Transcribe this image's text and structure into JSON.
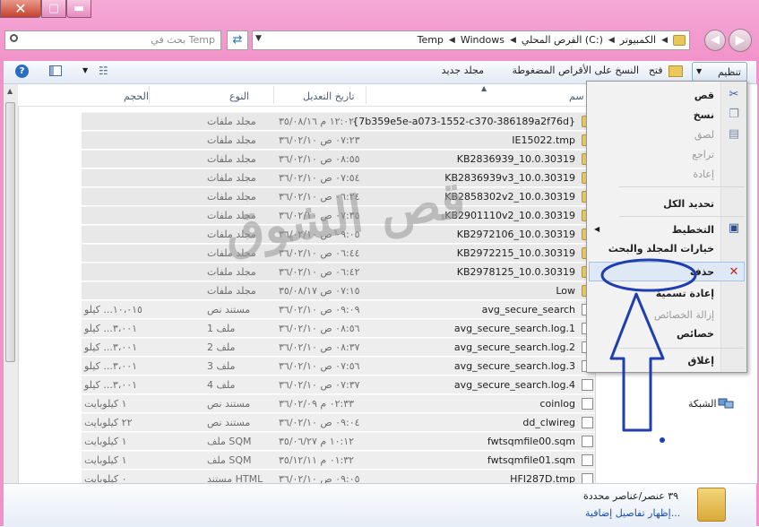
{
  "window": {
    "close_glyph": "✕",
    "max_glyph": "▢",
    "min_glyph": "▬"
  },
  "address": {
    "search_placeholder": "بحث في Temp",
    "crumbs": [
      "الكمبيوتر",
      "القرص المحلي (C:)",
      "Windows",
      "Temp"
    ]
  },
  "toolbar": {
    "organize": "تنظيم",
    "open": "فتح",
    "burn": "النسخ على الأقراص المضغوطة",
    "new_folder": "مجلد جديد"
  },
  "columns": {
    "name": "سم",
    "date": "تاريخ التعديل",
    "type": "النوع",
    "size": "الحجم"
  },
  "rows": [
    {
      "name": "{7b359e5e-a073-1552-c370-386189a2f76d}",
      "date": "١٢:٠٢ م ٣٥/٠٨/١٦",
      "type": "مجلد ملفات",
      "size": "",
      "kind": "folder"
    },
    {
      "name": "IE15022.tmp",
      "date": "٠٧:٢٣ ص ٣٦/٠٢/١٠",
      "type": "مجلد ملفات",
      "size": "",
      "kind": "folder"
    },
    {
      "name": "KB2836939_10.0.30319",
      "date": "٠٨:٥٥ ص ٣٦/٠٢/١٠",
      "type": "مجلد ملفات",
      "size": "",
      "kind": "folder"
    },
    {
      "name": "KB2836939v3_10.0.30319",
      "date": "٠٧:٥٤ ص ٣٦/٠٢/١٠",
      "type": "مجلد ملفات",
      "size": "",
      "kind": "folder"
    },
    {
      "name": "KB2858302v2_10.0.30319",
      "date": "٠٦:٢٤ ص ٣٦/٠٢/١٠",
      "type": "مجلد ملفات",
      "size": "",
      "kind": "folder"
    },
    {
      "name": "KB2901110v2_10.0.30319",
      "date": "٠٧:٣٥ ص ٣٦/٠٢/١٠",
      "type": "مجلد ملفات",
      "size": "",
      "kind": "folder"
    },
    {
      "name": "KB2972106_10.0.30319",
      "date": "٠٩:٠٥ ص ٣٦/٠٢/١٠",
      "type": "مجلد ملفات",
      "size": "",
      "kind": "folder"
    },
    {
      "name": "KB2972215_10.0.30319",
      "date": "٠٦:٤٤ ص ٣٦/٠٢/١٠",
      "type": "مجلد ملفات",
      "size": "",
      "kind": "folder"
    },
    {
      "name": "KB2978125_10.0.30319",
      "date": "٠٦:٤٢ ص ٣٦/٠٢/١٠",
      "type": "مجلد ملفات",
      "size": "",
      "kind": "folder"
    },
    {
      "name": "Low",
      "date": "٠٧:١٥ ص ٣٥/٠٨/١٧",
      "type": "مجلد ملفات",
      "size": "",
      "kind": "folder"
    },
    {
      "name": "avg_secure_search",
      "date": "٠٩:٠٩ ص ٣٦/٠٢/١٠",
      "type": "مستند نص",
      "size": "١٠،٠١٥... كيلو",
      "kind": "doc"
    },
    {
      "name": "avg_secure_search.log.1",
      "date": "٠٨:٥٦ ص ٣٦/٠٢/١٠",
      "type": "ملف 1",
      "size": "٣،٠٠١... كيلو",
      "kind": "doc"
    },
    {
      "name": "avg_secure_search.log.2",
      "date": "٠٨:٣٧ ص ٣٦/٠٢/١٠",
      "type": "ملف 2",
      "size": "٣،٠٠١... كيلو",
      "kind": "doc"
    },
    {
      "name": "avg_secure_search.log.3",
      "date": "٠٧:٥٦ ص ٣٦/٠٢/١٠",
      "type": "ملف 3",
      "size": "٣،٠٠١... كيلو",
      "kind": "doc"
    },
    {
      "name": "avg_secure_search.log.4",
      "date": "٠٧:٣٧ ص ٣٦/٠٢/١٠",
      "type": "ملف 4",
      "size": "٣،٠٠١... كيلو",
      "kind": "doc"
    },
    {
      "name": "coinlog",
      "date": "٠٢:٣٣ م ٣٦/٠٢/٠٩",
      "type": "مستند نص",
      "size": "١ كيلوبايت",
      "kind": "doc"
    },
    {
      "name": "dd_clwireg",
      "date": "٠٩:٠٤ ص ٣٦/٠٢/١٠",
      "type": "مستند نص",
      "size": "٢٢ كيلوبايت",
      "kind": "doc"
    },
    {
      "name": "fwtsqmfile00.sqm",
      "date": "١٠:١٢ م ٣٥/٠٦/٢٧",
      "type": "ملف SQM",
      "size": "١ كيلوبايت",
      "kind": "doc"
    },
    {
      "name": "fwtsqmfile01.sqm",
      "date": "٠١:٣٢ م ٣٥/١٢/١١",
      "type": "ملف SQM",
      "size": "١ كيلوبايت",
      "kind": "doc"
    },
    {
      "name": "HFI287D.tmp",
      "date": "٠٩:٠٥ ص ٣٦/٠٢/١٠",
      "type": "مستند HTML",
      "size": "٠ كيلوبايت",
      "kind": "doc"
    }
  ],
  "menu": {
    "cut": "قص",
    "copy": "نسخ",
    "paste": "لصق",
    "undo": "تراجع",
    "redo": "إعادة",
    "select_all": "تحديد الكل",
    "layout": "التخطيط",
    "folder_options": "خيارات المجلد والبحث",
    "delete": "حذف",
    "rename": "إعادة تسمية",
    "remove_props": "إزالة الخصائص",
    "properties": "خصائص",
    "close": "إغلاق"
  },
  "navpane": {
    "network": "الشبكة"
  },
  "details": {
    "count": "٣٩ عنصر/عناصر محددة",
    "more": "إظهار تفاصيل إضافية..."
  },
  "watermark": "قص الشوق",
  "colors": {
    "frame": "#f192c9",
    "annotation": "#1f3fb0"
  }
}
